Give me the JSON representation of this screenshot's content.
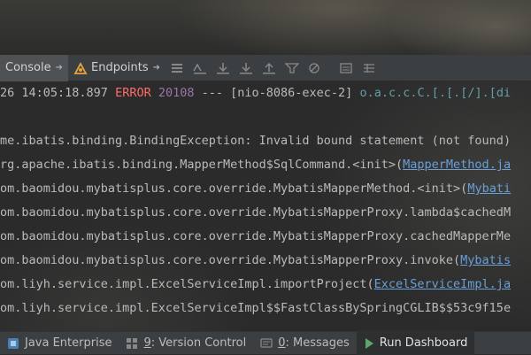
{
  "toolbar": {
    "tabs": [
      {
        "label": "Console"
      },
      {
        "label": "Endpoints"
      }
    ]
  },
  "console": {
    "lines": [
      {
        "prefix": "26 ",
        "time": "14:05:18.897",
        "sp1": " ",
        "level": "ERROR",
        "sp2": " ",
        "pid": "20108",
        "rest": " --- [nio-8086-exec-2] ",
        "logger": "o.a.c.c.C.[.[.[/].[di"
      },
      {
        "text": "me.ibatis.binding.BindingException: Invalid bound statement (not found)"
      },
      {
        "text": "rg.apache.ibatis.binding.MapperMethod$SqlCommand.<init>(",
        "link": "MapperMethod.ja"
      },
      {
        "text": "om.baomidou.mybatisplus.core.override.MybatisMapperMethod.<init>(",
        "link": "Mybati"
      },
      {
        "text": "om.baomidou.mybatisplus.core.override.MybatisMapperProxy.lambda$cachedM"
      },
      {
        "text": "om.baomidou.mybatisplus.core.override.MybatisMapperProxy.cachedMapperMe"
      },
      {
        "text": "om.baomidou.mybatisplus.core.override.MybatisMapperProxy.invoke(",
        "link": "Mybatis"
      },
      {
        "text": "om.liyh.service.impl.ExcelServiceImpl.importProject(",
        "link": "ExcelServiceImpl.ja"
      },
      {
        "text": "om.liyh.service.impl.ExcelServiceImpl$$FastClassBySpringCGLIB$$53c9f15e"
      }
    ]
  },
  "statusbar": {
    "items": [
      {
        "label": "Java Enterprise"
      },
      {
        "prefix": "9",
        "label": ": Version Control"
      },
      {
        "prefix": "0",
        "label": ": Messages"
      },
      {
        "label": "Run Dashboard"
      }
    ]
  },
  "colors": {
    "error": "#ff6b68",
    "link": "#6a9fd8",
    "number": "#9876aa",
    "run_green": "#59a869"
  }
}
